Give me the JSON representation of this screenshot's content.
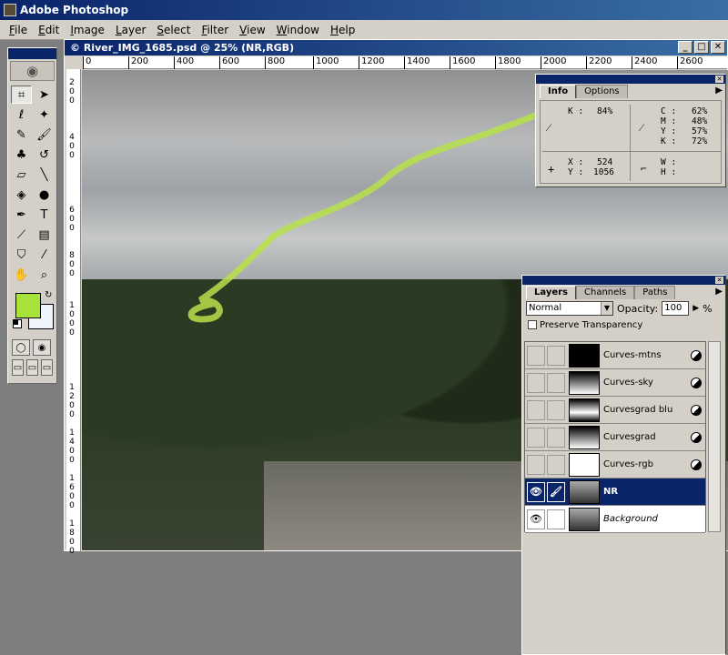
{
  "app": {
    "title": "Adobe Photoshop"
  },
  "menu": [
    "File",
    "Edit",
    "Image",
    "Layer",
    "Select",
    "Filter",
    "View",
    "Window",
    "Help"
  ],
  "document": {
    "title": "© River_IMG_1685.psd @ 25% (NR,RGB)",
    "ruler_top": [
      "0",
      "200",
      "400",
      "600",
      "800",
      "1000",
      "1200",
      "1400",
      "1600",
      "1800",
      "2000",
      "2200",
      "2400",
      "2600"
    ],
    "ruler_left": [
      "2",
      "0",
      "0",
      "4",
      "0",
      "0",
      "6",
      "0",
      "0",
      "8",
      "0",
      "0",
      "1",
      "0",
      "0",
      "0",
      "1",
      "2",
      "0",
      "0",
      "1",
      "4",
      "0",
      "0",
      "1",
      "6",
      "0",
      "0",
      "1",
      "8",
      "0",
      "0"
    ]
  },
  "colors": {
    "foreground": "#a8e33b",
    "background": "#f0f4fc",
    "annotation_stroke": "#b8e04a"
  },
  "info_panel": {
    "tabs": [
      "Info",
      "Options"
    ],
    "k_label": "K :",
    "k_value": "84%",
    "c_label": "C :",
    "c_value": "62%",
    "m_label": "M :",
    "m_value": "48%",
    "y_label": "Y :",
    "y_value": "57%",
    "k2_label": "K :",
    "k2_value": "72%",
    "x_label": "X :",
    "x_value": "524",
    "ypos_label": "Y :",
    "ypos_value": "1056",
    "w_label": "W :",
    "h_label": "H :"
  },
  "layers_panel": {
    "tabs": [
      "Layers",
      "Channels",
      "Paths"
    ],
    "blend_mode": "Normal",
    "opacity_label": "Opacity:",
    "opacity_value": "100",
    "opacity_unit": "%",
    "preserve_label": "Preserve Transparency",
    "layers": [
      {
        "name": "Curves-mtns"
      },
      {
        "name": "Curves-sky"
      },
      {
        "name": "Curvesgrad blu"
      },
      {
        "name": "Curvesgrad"
      },
      {
        "name": "Curves-rgb"
      },
      {
        "name": "NR"
      },
      {
        "name": "Background"
      }
    ]
  },
  "icons": [
    "eye-icon",
    "brush-icon",
    "marquee-icon",
    "move-icon",
    "lasso-icon",
    "magic-wand-icon",
    "crop-icon",
    "slice-icon",
    "healing-icon",
    "pencil-icon",
    "stamp-icon",
    "history-brush-icon",
    "eraser-icon",
    "line-icon",
    "blur-icon",
    "dodge-icon",
    "pen-icon",
    "type-icon",
    "measure-icon",
    "gradient-icon",
    "bucket-icon",
    "eyedropper-icon",
    "hand-icon",
    "zoom-icon"
  ]
}
